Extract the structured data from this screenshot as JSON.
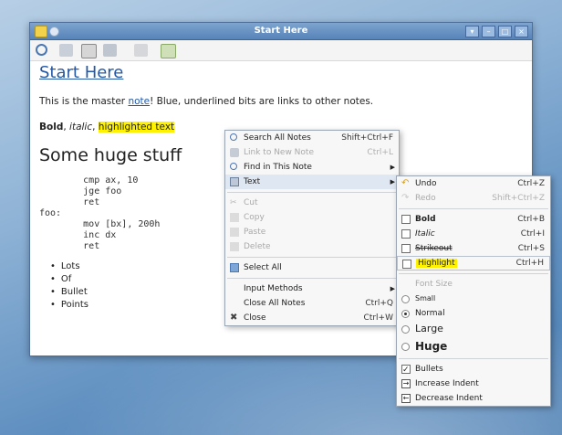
{
  "window": {
    "title": "Start Here"
  },
  "note": {
    "title": "Start Here",
    "intro_before": "This is the master ",
    "intro_link": "note",
    "intro_after": "! Blue, underlined bits are links to other notes.",
    "bold": "Bold",
    "sep1": ", ",
    "italic": "italic",
    "sep2": ", ",
    "highlighted": "highlighted text",
    "huge": "Some huge stuff",
    "code": "        cmp ax, 10\n        jge foo\n        ret\nfoo:\n        mov [bx], 200h\n        inc dx\n        ret",
    "bullets": [
      "Lots",
      "Of",
      "Bullet",
      "Points"
    ]
  },
  "context_menu": {
    "items": [
      {
        "label": "Search All Notes",
        "accel": "Shift+Ctrl+F",
        "icon": "search-icon"
      },
      {
        "label": "Link to New Note",
        "accel": "Ctrl+L",
        "icon": "link-icon"
      },
      {
        "label": "Find in This Note",
        "icon": "find-icon"
      },
      {
        "label": "Text",
        "icon": "text-icon"
      },
      {
        "label": "Cut",
        "icon": "cut-icon"
      },
      {
        "label": "Copy",
        "icon": "copy-icon"
      },
      {
        "label": "Paste",
        "icon": "paste-icon"
      },
      {
        "label": "Delete",
        "icon": "delete-icon"
      },
      {
        "label": "Select All",
        "icon": "select-all-icon"
      },
      {
        "label": "Input Methods"
      },
      {
        "label": "Close All Notes",
        "accel": "Ctrl+Q"
      },
      {
        "label": "Close",
        "accel": "Ctrl+W",
        "icon": "close-icon"
      }
    ]
  },
  "text_submenu": {
    "undo": {
      "label": "Undo",
      "accel": "Ctrl+Z"
    },
    "redo": {
      "label": "Redo",
      "accel": "Shift+Ctrl+Z"
    },
    "bold": {
      "label": "Bold",
      "accel": "Ctrl+B"
    },
    "italic": {
      "label": "Italic",
      "accel": "Ctrl+I"
    },
    "strikeout": {
      "label": "Strikeout",
      "accel": "Ctrl+S"
    },
    "highlight": {
      "label": "Highlight",
      "accel": "Ctrl+H"
    },
    "font_size_header": "Font Size",
    "small": "Small",
    "normal": "Normal",
    "large": "Large",
    "huge": "Huge",
    "bullets": "Bullets",
    "increase_indent": "Increase Indent",
    "decrease_indent": "Decrease Indent"
  },
  "colors": {
    "link": "#2458a6",
    "highlight": "#fff200",
    "titlebar": "#6b94c4"
  }
}
